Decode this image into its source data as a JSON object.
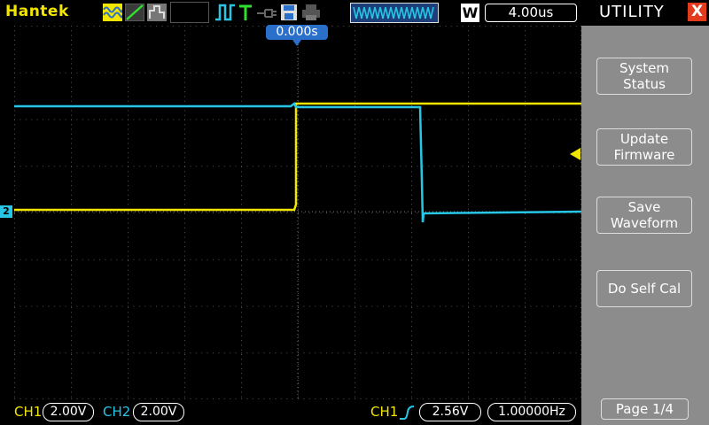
{
  "brand": "Hantek",
  "timebase": {
    "prefix": "W",
    "value": "4.00us"
  },
  "time_offset": "0.000s",
  "channel_marker": "2",
  "panel": {
    "title": "UTILITY",
    "close_glyph": "X",
    "buttons": [
      {
        "line1": "System",
        "line2": "Status"
      },
      {
        "line1": "Update",
        "line2": "Firmware"
      },
      {
        "line1": "Save",
        "line2": "Waveform"
      },
      {
        "line1": "Do Self Cal",
        "line2": ""
      }
    ],
    "page": "Page 1/4"
  },
  "bottom": {
    "ch1_label": "CH1",
    "ch1_scale": "2.00V",
    "ch2_label": "CH2",
    "ch2_scale": "2.00V",
    "trigger_source": "CH1",
    "trigger_level": "2.56V",
    "frequency": "1.00000Hz"
  },
  "colors": {
    "ch1": "#f2e600",
    "ch2": "#27c6e6",
    "panel_bg": "#8c8c8c",
    "close": "#e33b1e",
    "marker": "#2a6fc9"
  },
  "icons": [
    "waveform-icon",
    "ramp-icon",
    "persistence-icon",
    "run-icon",
    "trigger-icon",
    "probe-icon",
    "save-icon",
    "print-icon",
    "memory-depth-icon"
  ]
}
